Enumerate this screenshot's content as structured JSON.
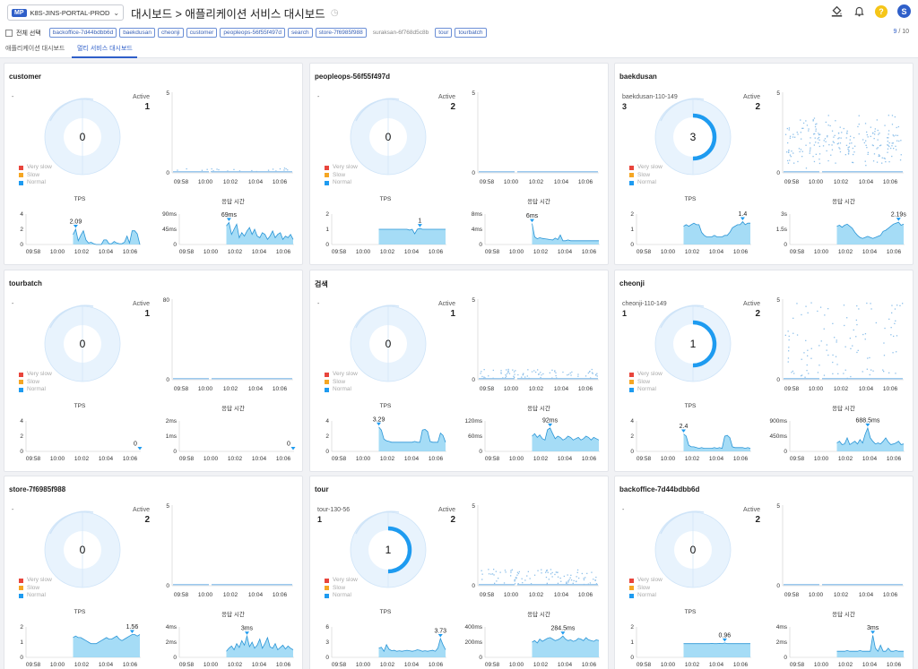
{
  "header": {
    "project_badge": "MP",
    "project_name": "K8S-JINS-PORTAL-PROD",
    "breadcrumb": "대시보드 > 애플리케이션 서비스 대시보드"
  },
  "filters": {
    "select_all": "전체 선택",
    "chips": [
      {
        "label": "backoffice-7d44bdbb6d",
        "on": true
      },
      {
        "label": "baekdusan",
        "on": true
      },
      {
        "label": "cheonji",
        "on": true
      },
      {
        "label": "customer",
        "on": true
      },
      {
        "label": "peopleops-56f55f497d",
        "on": true
      },
      {
        "label": "search",
        "on": true
      },
      {
        "label": "store-7f6985f988",
        "on": true
      },
      {
        "label": "suraksan-6f768d5c8b",
        "on": false
      },
      {
        "label": "tour",
        "on": true
      },
      {
        "label": "tourbatch",
        "on": true
      }
    ],
    "page_current": "9",
    "page_total": " / 10"
  },
  "tabs": [
    "애플리케이션 대시보드",
    "멀티 서비스 대시보드"
  ],
  "colors": {
    "accent": "#2f5fc9",
    "normal": "#1e9bf0",
    "slow": "#f5a623",
    "very_slow": "#e8453c",
    "area": "#8fd3f4",
    "area_line": "#2a95d6"
  },
  "legend": [
    "Very slow",
    "Slow",
    "Normal"
  ],
  "active_label": "Active",
  "tps_label": "TPS",
  "resp_label": "응답 시간",
  "time_ticks": [
    "09:58",
    "10:00",
    "10:02",
    "10:04",
    "10:06"
  ],
  "cards": [
    {
      "title": "customer",
      "host": "-",
      "host_count": "",
      "active": "1",
      "pie_value": "0",
      "pie_arc": 0,
      "scatter_ticks": [
        "5",
        "0"
      ],
      "scatter_density": 0.1,
      "scatter_band": 0.05,
      "tps_ticks": [
        "4",
        "2",
        "0"
      ],
      "tps_max": 4,
      "tps_peak": "2.09",
      "tps_values": [
        0,
        0,
        0,
        0,
        0,
        0,
        0,
        0,
        0,
        0,
        0,
        0,
        0,
        0,
        0,
        0,
        0,
        0,
        1.3,
        2.0,
        0.5,
        1.2,
        1.8,
        0.6,
        0.2,
        0.3,
        0.1,
        0,
        0,
        0,
        0.6,
        0.6,
        0.1,
        0.1,
        0.4,
        0.2,
        0.1,
        0.1,
        0.3,
        1.1,
        0.2,
        1.8,
        1.8,
        1.4,
        0
      ],
      "resp_ticks": [
        "90ms",
        "45ms",
        "0"
      ],
      "resp_max": 90,
      "resp_peak": "69ms",
      "resp_values": [
        0,
        0,
        0,
        0,
        0,
        0,
        0,
        0,
        0,
        0,
        0,
        0,
        0,
        0,
        0,
        0,
        0,
        0,
        55,
        65,
        30,
        45,
        60,
        20,
        35,
        25,
        40,
        50,
        30,
        45,
        25,
        20,
        35,
        30,
        15,
        25,
        40,
        20,
        30,
        35,
        15,
        25,
        20,
        30,
        15
      ]
    },
    {
      "title": "peopleops-56f55f497d",
      "host": "-",
      "host_count": "",
      "active": "2",
      "pie_value": "0",
      "pie_arc": 0,
      "scatter_ticks": [
        "5",
        "0"
      ],
      "scatter_density": 0,
      "scatter_band": 0,
      "tps_ticks": [
        "2",
        "1",
        "0"
      ],
      "tps_max": 2,
      "tps_peak": "1",
      "tps_values": [
        0,
        0,
        0,
        0,
        0,
        0,
        0,
        0,
        0,
        0,
        0,
        0,
        0,
        0,
        0,
        0,
        0,
        0,
        1,
        1,
        1,
        1,
        1,
        1,
        1,
        1,
        1,
        1,
        1,
        1,
        0.95,
        1,
        0.7,
        1,
        1.05,
        1,
        1,
        1,
        1,
        1,
        1,
        1,
        1,
        1,
        1
      ],
      "resp_ticks": [
        "8ms",
        "4ms",
        "0"
      ],
      "resp_max": 8,
      "resp_peak": "6ms",
      "resp_values": [
        0,
        0,
        0,
        0,
        0,
        0,
        0,
        0,
        0,
        0,
        0,
        0,
        0,
        0,
        0,
        0,
        0,
        0,
        5.5,
        2,
        1.5,
        1.8,
        1.6,
        1.5,
        1.4,
        1.3,
        1.2,
        1.7,
        1.3,
        2.5,
        1,
        1,
        1.2,
        1,
        1,
        1,
        1,
        1,
        1,
        1,
        1,
        1,
        1,
        1,
        1
      ]
    },
    {
      "title": "baekdusan",
      "host": "baekdusan-110-149",
      "host_count": "3",
      "active": "2",
      "pie_value": "3",
      "pie_arc": 0.5,
      "scatter_ticks": [
        "5",
        "0"
      ],
      "scatter_density": 1,
      "scatter_band": 0.45,
      "tps_ticks": [
        "2",
        "1",
        "0"
      ],
      "tps_max": 2,
      "tps_peak": "1.4",
      "tps_values": [
        0,
        0,
        0,
        0,
        0,
        0,
        0,
        0,
        0,
        0,
        0,
        0,
        0,
        0,
        0,
        0,
        0,
        0,
        1.2,
        1.3,
        1.2,
        1.3,
        1.4,
        1.3,
        1.3,
        0.8,
        0.6,
        0.5,
        0.5,
        0.5,
        0.6,
        0.5,
        0.5,
        0.5,
        0.6,
        0.6,
        0.8,
        1.1,
        1.2,
        1.3,
        1.3,
        1.5,
        1.3,
        1.4,
        1.4
      ],
      "resp_ticks": [
        "3s",
        "1.5s",
        "0"
      ],
      "resp_max": 3,
      "resp_peak": "2.19s",
      "resp_values": [
        0,
        0,
        0,
        0,
        0,
        0,
        0,
        0,
        0,
        0,
        0,
        0,
        0,
        0,
        0,
        0,
        0,
        0,
        1.8,
        1.9,
        1.7,
        1.9,
        2,
        1.8,
        1.6,
        1.2,
        0.9,
        0.7,
        0.6,
        0.7,
        0.8,
        0.7,
        0.6,
        0.7,
        0.8,
        0.9,
        1.3,
        1.4,
        1.6,
        1.8,
        2,
        2.1,
        2.2,
        1.9,
        2
      ]
    },
    {
      "title": "tourbatch",
      "host": "-",
      "host_count": "",
      "active": "1",
      "pie_value": "0",
      "pie_arc": 0,
      "scatter_ticks": [
        "80",
        "0"
      ],
      "scatter_density": 0,
      "scatter_band": 0,
      "tps_ticks": [
        "4",
        "2",
        "0"
      ],
      "tps_max": 4,
      "tps_peak": "0",
      "tps_values": [
        0,
        0,
        0,
        0,
        0,
        0,
        0,
        0,
        0,
        0,
        0,
        0,
        0,
        0,
        0,
        0,
        0,
        0,
        0,
        0,
        0,
        0,
        0,
        0,
        0,
        0,
        0,
        0,
        0,
        0,
        0,
        0,
        0,
        0,
        0,
        0,
        0,
        0,
        0,
        0,
        0,
        0,
        0,
        0,
        0
      ],
      "resp_ticks": [
        "2ms",
        "1ms",
        "0"
      ],
      "resp_max": 2,
      "resp_peak": "0",
      "resp_values": [
        0,
        0,
        0,
        0,
        0,
        0,
        0,
        0,
        0,
        0,
        0,
        0,
        0,
        0,
        0,
        0,
        0,
        0,
        0,
        0,
        0,
        0,
        0,
        0,
        0,
        0,
        0,
        0,
        0,
        0,
        0,
        0,
        0,
        0,
        0,
        0,
        0,
        0,
        0,
        0,
        0,
        0,
        0,
        0,
        0
      ]
    },
    {
      "title": "검색",
      "host": "-",
      "host_count": "",
      "active": "1",
      "pie_value": "0",
      "pie_arc": 0,
      "scatter_ticks": [
        "5",
        "0"
      ],
      "scatter_density": 0.35,
      "scatter_band": 0.12,
      "tps_ticks": [
        "4",
        "2",
        "0"
      ],
      "tps_max": 4,
      "tps_peak": "3.29",
      "tps_values": [
        0,
        0,
        0,
        0,
        0,
        0,
        0,
        0,
        0,
        0,
        0,
        0,
        0,
        0,
        0,
        0,
        0,
        0,
        3.2,
        2.8,
        1.6,
        1.4,
        1.3,
        1.2,
        1.2,
        1.2,
        1.2,
        1.2,
        1.2,
        1.2,
        1.2,
        1.2,
        1.3,
        1.2,
        1.2,
        2.8,
        2.9,
        2.6,
        1.3,
        1.2,
        1.2,
        1.2,
        2.4,
        2.1,
        1.2
      ],
      "resp_ticks": [
        "120ms",
        "60ms",
        "0"
      ],
      "resp_max": 120,
      "resp_peak": "92ms",
      "resp_values": [
        0,
        0,
        0,
        0,
        0,
        0,
        0,
        0,
        0,
        0,
        0,
        0,
        0,
        0,
        0,
        0,
        0,
        0,
        60,
        70,
        55,
        65,
        50,
        45,
        85,
        92,
        70,
        50,
        60,
        55,
        45,
        50,
        60,
        55,
        45,
        50,
        55,
        45,
        50,
        60,
        55,
        45,
        55,
        50,
        45
      ]
    },
    {
      "title": "cheonji",
      "host": "cheonji-110-149",
      "host_count": "1",
      "active": "2",
      "pie_value": "1",
      "pie_arc": 0.5,
      "scatter_ticks": [
        "5",
        "0"
      ],
      "scatter_density": 0.5,
      "scatter_band": 1,
      "tps_ticks": [
        "4",
        "2",
        "0"
      ],
      "tps_max": 4,
      "tps_peak": "2.4",
      "tps_values": [
        0,
        0,
        0,
        0,
        0,
        0,
        0,
        0,
        0,
        0,
        0,
        0,
        0,
        0,
        0,
        0,
        0,
        0,
        2.3,
        2.0,
        0.8,
        0.6,
        0.6,
        0.5,
        0.4,
        0.5,
        0.4,
        0.4,
        0.4,
        0.4,
        0.5,
        0.4,
        0.5,
        0.4,
        2.0,
        2.1,
        1.8,
        0.6,
        0.5,
        0.5,
        0.5,
        0.5,
        0.4,
        0.5,
        0.4
      ],
      "resp_ticks": [
        "900ms",
        "450ms",
        "0"
      ],
      "resp_max": 900,
      "resp_peak": "688.5ms",
      "resp_values": [
        0,
        0,
        0,
        0,
        0,
        0,
        0,
        0,
        0,
        0,
        0,
        0,
        0,
        0,
        0,
        0,
        0,
        0,
        250,
        300,
        200,
        220,
        400,
        200,
        250,
        300,
        220,
        350,
        250,
        500,
        690,
        400,
        300,
        220,
        250,
        220,
        300,
        400,
        280,
        200,
        220,
        250,
        300,
        200,
        220
      ]
    },
    {
      "title": "store-7f6985f988",
      "host": "-",
      "host_count": "",
      "active": "2",
      "pie_value": "0",
      "pie_arc": 0,
      "scatter_ticks": [
        "5",
        "0"
      ],
      "scatter_density": 0,
      "scatter_band": 0,
      "tps_ticks": [
        "2",
        "1",
        "0"
      ],
      "tps_max": 2,
      "tps_peak": "1.56",
      "tps_values": [
        0,
        0,
        0,
        0,
        0,
        0,
        0,
        0,
        0,
        0,
        0,
        0,
        0,
        0,
        0,
        0,
        0,
        0,
        1.3,
        1.4,
        1.3,
        1.3,
        1.2,
        1.1,
        1.0,
        0.9,
        0.9,
        0.9,
        1.0,
        1.1,
        1.2,
        1.3,
        1.2,
        1.2,
        1.3,
        1.4,
        1.2,
        1.1,
        1.2,
        1.3,
        1.4,
        1.5,
        1.5,
        1.4,
        1.5
      ],
      "resp_ticks": [
        "4ms",
        "2ms",
        "0"
      ],
      "resp_max": 4,
      "resp_peak": "3ms",
      "resp_values": [
        0,
        0,
        0,
        0,
        0,
        0,
        0,
        0,
        0,
        0,
        0,
        0,
        0,
        0,
        0,
        0,
        0,
        0,
        0.8,
        1.2,
        1.5,
        1.0,
        1.8,
        1.3,
        2.2,
        1.6,
        2.8,
        1.4,
        2.0,
        1.2,
        1.6,
        2.4,
        1.2,
        1.8,
        2.6,
        1.4,
        1.2,
        1.8,
        1.0,
        1.3,
        1.6,
        1.1,
        1.5,
        1.2,
        1.0
      ]
    },
    {
      "title": "tour",
      "host": "tour-130-56",
      "host_count": "1",
      "active": "2",
      "pie_value": "1",
      "pie_arc": 0.5,
      "scatter_ticks": [
        "5",
        "0"
      ],
      "scatter_density": 0.45,
      "scatter_band": 0.2,
      "tps_ticks": [
        "6",
        "3",
        "0"
      ],
      "tps_max": 6,
      "tps_peak": "3.73",
      "tps_values": [
        0,
        0,
        0,
        0,
        0,
        0,
        0,
        0,
        0,
        0,
        0,
        0,
        0,
        0,
        0,
        0,
        0,
        0,
        1.8,
        2.0,
        1.2,
        2.5,
        1.6,
        1.3,
        1.4,
        1.2,
        1.3,
        1.2,
        1.3,
        1.4,
        1.3,
        1.2,
        1.3,
        1.5,
        1.4,
        1.2,
        1.3,
        1.2,
        1.3,
        1.4,
        1.2,
        1.8,
        3.7,
        2.5,
        1.5
      ],
      "resp_ticks": [
        "400ms",
        "200ms",
        "0"
      ],
      "resp_max": 400,
      "resp_peak": "284.5ms",
      "resp_values": [
        0,
        0,
        0,
        0,
        0,
        0,
        0,
        0,
        0,
        0,
        0,
        0,
        0,
        0,
        0,
        0,
        0,
        0,
        200,
        220,
        190,
        240,
        210,
        230,
        250,
        260,
        240,
        220,
        230,
        250,
        280,
        240,
        220,
        230,
        210,
        220,
        250,
        240,
        220,
        260,
        230,
        220,
        210,
        230,
        220
      ]
    },
    {
      "title": "backoffice-7d44bdbb6d",
      "host": "-",
      "host_count": "",
      "active": "2",
      "pie_value": "0",
      "pie_arc": 0,
      "scatter_ticks": [
        "5",
        "0"
      ],
      "scatter_density": 0,
      "scatter_band": 0,
      "tps_ticks": [
        "2",
        "1",
        "0"
      ],
      "tps_max": 2,
      "tps_peak": "0.96",
      "tps_values": [
        0,
        0,
        0,
        0,
        0,
        0,
        0,
        0,
        0,
        0,
        0,
        0,
        0,
        0,
        0,
        0,
        0,
        0,
        0.9,
        0.9,
        0.9,
        0.9,
        0.9,
        0.9,
        0.9,
        0.9,
        0.9,
        0.9,
        0.9,
        0.92,
        0.9,
        0.9,
        0.92,
        0.9,
        0.95,
        0.9,
        0.9,
        0.9,
        0.9,
        0.9,
        0.9,
        0.9,
        0.9,
        0.9,
        0.9
      ],
      "resp_ticks": [
        "4ms",
        "2ms",
        "0"
      ],
      "resp_max": 4,
      "resp_peak": "3ms",
      "resp_values": [
        0,
        0,
        0,
        0,
        0,
        0,
        0,
        0,
        0,
        0,
        0,
        0,
        0,
        0,
        0,
        0,
        0,
        0,
        0.8,
        0.8,
        0.8,
        0.8,
        0.9,
        0.8,
        0.8,
        0.8,
        0.8,
        0.9,
        0.8,
        0.8,
        0.8,
        0.8,
        2.9,
        1.2,
        0.8,
        1.6,
        0.8,
        0.8,
        1.2,
        0.8,
        0.8,
        0.9,
        0.8,
        0.8,
        0.8
      ]
    }
  ]
}
